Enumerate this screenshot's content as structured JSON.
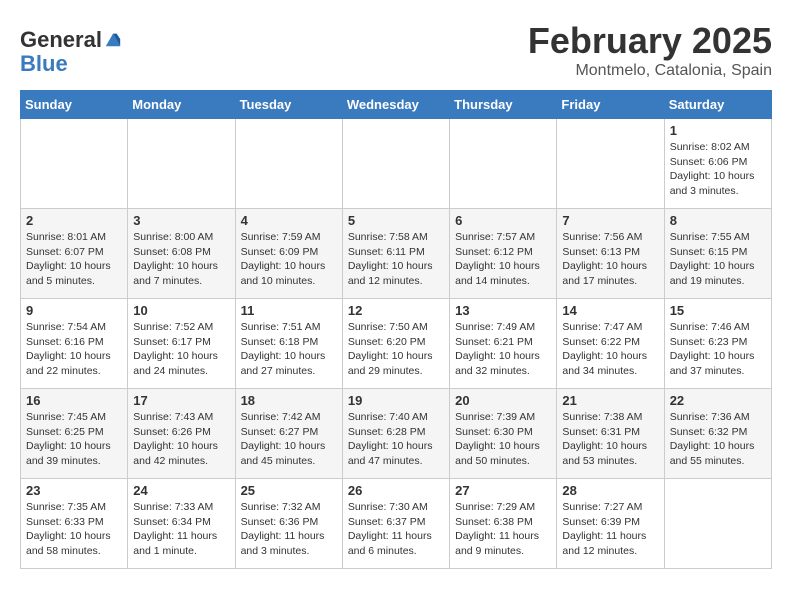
{
  "header": {
    "logo_line1": "General",
    "logo_line2": "Blue",
    "title": "February 2025",
    "subtitle": "Montmelo, Catalonia, Spain"
  },
  "weekdays": [
    "Sunday",
    "Monday",
    "Tuesday",
    "Wednesday",
    "Thursday",
    "Friday",
    "Saturday"
  ],
  "weeks": [
    [
      {
        "day": "",
        "info": ""
      },
      {
        "day": "",
        "info": ""
      },
      {
        "day": "",
        "info": ""
      },
      {
        "day": "",
        "info": ""
      },
      {
        "day": "",
        "info": ""
      },
      {
        "day": "",
        "info": ""
      },
      {
        "day": "1",
        "info": "Sunrise: 8:02 AM\nSunset: 6:06 PM\nDaylight: 10 hours\nand 3 minutes."
      }
    ],
    [
      {
        "day": "2",
        "info": "Sunrise: 8:01 AM\nSunset: 6:07 PM\nDaylight: 10 hours\nand 5 minutes."
      },
      {
        "day": "3",
        "info": "Sunrise: 8:00 AM\nSunset: 6:08 PM\nDaylight: 10 hours\nand 7 minutes."
      },
      {
        "day": "4",
        "info": "Sunrise: 7:59 AM\nSunset: 6:09 PM\nDaylight: 10 hours\nand 10 minutes."
      },
      {
        "day": "5",
        "info": "Sunrise: 7:58 AM\nSunset: 6:11 PM\nDaylight: 10 hours\nand 12 minutes."
      },
      {
        "day": "6",
        "info": "Sunrise: 7:57 AM\nSunset: 6:12 PM\nDaylight: 10 hours\nand 14 minutes."
      },
      {
        "day": "7",
        "info": "Sunrise: 7:56 AM\nSunset: 6:13 PM\nDaylight: 10 hours\nand 17 minutes."
      },
      {
        "day": "8",
        "info": "Sunrise: 7:55 AM\nSunset: 6:15 PM\nDaylight: 10 hours\nand 19 minutes."
      }
    ],
    [
      {
        "day": "9",
        "info": "Sunrise: 7:54 AM\nSunset: 6:16 PM\nDaylight: 10 hours\nand 22 minutes."
      },
      {
        "day": "10",
        "info": "Sunrise: 7:52 AM\nSunset: 6:17 PM\nDaylight: 10 hours\nand 24 minutes."
      },
      {
        "day": "11",
        "info": "Sunrise: 7:51 AM\nSunset: 6:18 PM\nDaylight: 10 hours\nand 27 minutes."
      },
      {
        "day": "12",
        "info": "Sunrise: 7:50 AM\nSunset: 6:20 PM\nDaylight: 10 hours\nand 29 minutes."
      },
      {
        "day": "13",
        "info": "Sunrise: 7:49 AM\nSunset: 6:21 PM\nDaylight: 10 hours\nand 32 minutes."
      },
      {
        "day": "14",
        "info": "Sunrise: 7:47 AM\nSunset: 6:22 PM\nDaylight: 10 hours\nand 34 minutes."
      },
      {
        "day": "15",
        "info": "Sunrise: 7:46 AM\nSunset: 6:23 PM\nDaylight: 10 hours\nand 37 minutes."
      }
    ],
    [
      {
        "day": "16",
        "info": "Sunrise: 7:45 AM\nSunset: 6:25 PM\nDaylight: 10 hours\nand 39 minutes."
      },
      {
        "day": "17",
        "info": "Sunrise: 7:43 AM\nSunset: 6:26 PM\nDaylight: 10 hours\nand 42 minutes."
      },
      {
        "day": "18",
        "info": "Sunrise: 7:42 AM\nSunset: 6:27 PM\nDaylight: 10 hours\nand 45 minutes."
      },
      {
        "day": "19",
        "info": "Sunrise: 7:40 AM\nSunset: 6:28 PM\nDaylight: 10 hours\nand 47 minutes."
      },
      {
        "day": "20",
        "info": "Sunrise: 7:39 AM\nSunset: 6:30 PM\nDaylight: 10 hours\nand 50 minutes."
      },
      {
        "day": "21",
        "info": "Sunrise: 7:38 AM\nSunset: 6:31 PM\nDaylight: 10 hours\nand 53 minutes."
      },
      {
        "day": "22",
        "info": "Sunrise: 7:36 AM\nSunset: 6:32 PM\nDaylight: 10 hours\nand 55 minutes."
      }
    ],
    [
      {
        "day": "23",
        "info": "Sunrise: 7:35 AM\nSunset: 6:33 PM\nDaylight: 10 hours\nand 58 minutes."
      },
      {
        "day": "24",
        "info": "Sunrise: 7:33 AM\nSunset: 6:34 PM\nDaylight: 11 hours\nand 1 minute."
      },
      {
        "day": "25",
        "info": "Sunrise: 7:32 AM\nSunset: 6:36 PM\nDaylight: 11 hours\nand 3 minutes."
      },
      {
        "day": "26",
        "info": "Sunrise: 7:30 AM\nSunset: 6:37 PM\nDaylight: 11 hours\nand 6 minutes."
      },
      {
        "day": "27",
        "info": "Sunrise: 7:29 AM\nSunset: 6:38 PM\nDaylight: 11 hours\nand 9 minutes."
      },
      {
        "day": "28",
        "info": "Sunrise: 7:27 AM\nSunset: 6:39 PM\nDaylight: 11 hours\nand 12 minutes."
      },
      {
        "day": "",
        "info": ""
      }
    ]
  ]
}
